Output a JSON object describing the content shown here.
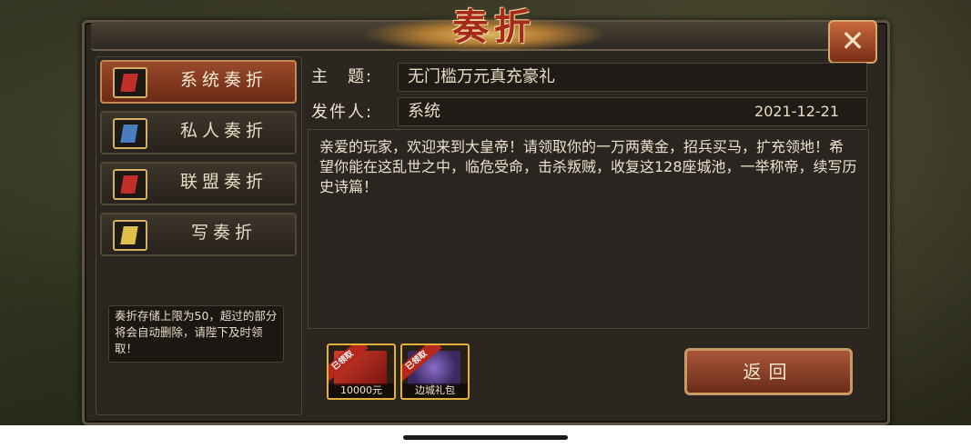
{
  "window": {
    "title": "奏折",
    "close_icon": "close-icon"
  },
  "sidebar": {
    "items": [
      {
        "label": "系统奏折",
        "icon": "red-memorial-icon",
        "active": true
      },
      {
        "label": "私人奏折",
        "icon": "blue-memorial-icon",
        "active": false
      },
      {
        "label": "联盟奏折",
        "icon": "red-memorial-icon",
        "active": false
      },
      {
        "label": "写奏折",
        "icon": "yellow-memorial-icon",
        "active": false
      }
    ],
    "notice": "奏折存储上限为50，超过的部分将会自动删除，请陛下及时领取！"
  },
  "message": {
    "subject_label": "主　题:",
    "subject": "无门槛万元真充豪礼",
    "sender_label": "发件人:",
    "sender": "系统",
    "date": "2021-12-21",
    "body": "亲爱的玩家，欢迎来到大皇帝！请领取你的一万两黄金，招兵买马，扩充领地！希望你能在这乱世之中，临危受命，击杀叛贼，收复这128座城池，一举称帝，续写历史诗篇！"
  },
  "attachments": [
    {
      "ribbon": "已领取",
      "caption": "10000元"
    },
    {
      "ribbon": "已领取",
      "caption": "边城礼包"
    }
  ],
  "actions": {
    "return_label": "返回"
  },
  "colors": {
    "accent": "#a62a1a",
    "gold": "#e2b23a",
    "active_tab": "#9a4a2a"
  }
}
